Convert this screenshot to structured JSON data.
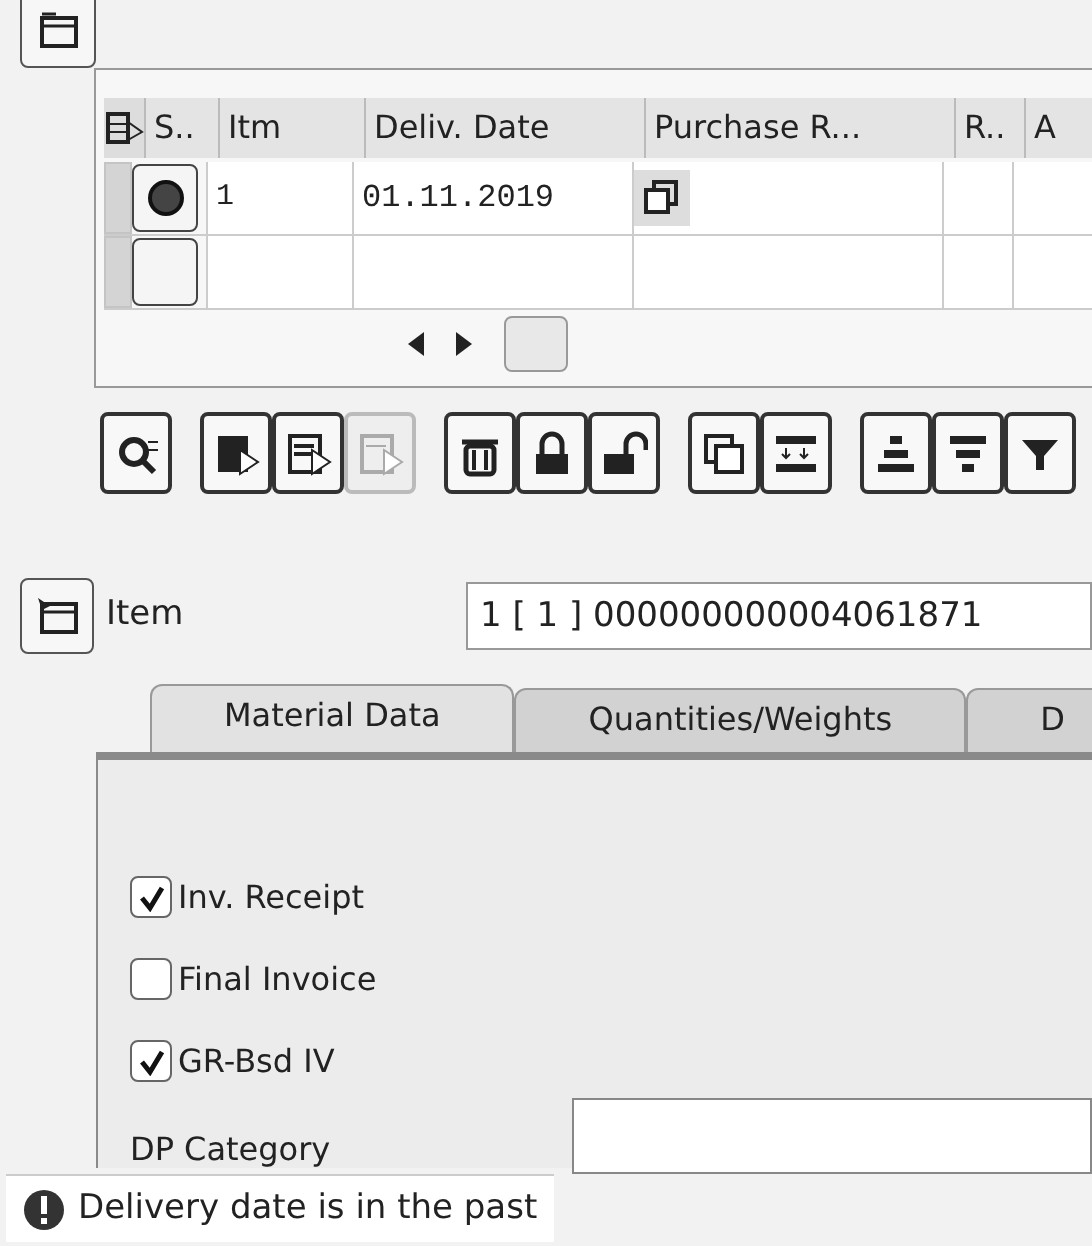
{
  "table": {
    "columns": [
      {
        "label": "S.."
      },
      {
        "label": "Itm"
      },
      {
        "label": "Deliv. Date"
      },
      {
        "label": "Purchase R..."
      },
      {
        "label": "R.."
      },
      {
        "label": "A"
      }
    ],
    "rows": [
      {
        "status_set": true,
        "item": "1",
        "deliv_date": "01.11.2019",
        "has_requisition_button": true
      },
      {
        "status_set": false,
        "has_requisition_button": false
      }
    ]
  },
  "toolbar": [
    {
      "disabled": false
    },
    {
      "disabled": false
    },
    {
      "disabled": false
    },
    {
      "disabled": true
    },
    {
      "disabled": false
    },
    {
      "disabled": false
    },
    {
      "disabled": false
    },
    {
      "disabled": false
    },
    {
      "disabled": false
    },
    {
      "disabled": false
    },
    {
      "disabled": false
    },
    {
      "disabled": false
    }
  ],
  "item": {
    "label": "Item",
    "value": "1 [ 1 ] 000000000004061871"
  },
  "tabs": [
    {
      "label": "Material Data",
      "selected": true
    },
    {
      "label": "Quantities/Weights",
      "selected": false
    },
    {
      "label": "D",
      "selected": false
    }
  ],
  "checkboxes": [
    {
      "label": "Inv. Receipt",
      "checked": true
    },
    {
      "label": "Final Invoice",
      "checked": false
    },
    {
      "label": "GR-Bsd IV",
      "checked": true
    }
  ],
  "dp_category": {
    "label": "DP Category"
  },
  "status_bar": {
    "message": "Delivery date is in the past"
  }
}
